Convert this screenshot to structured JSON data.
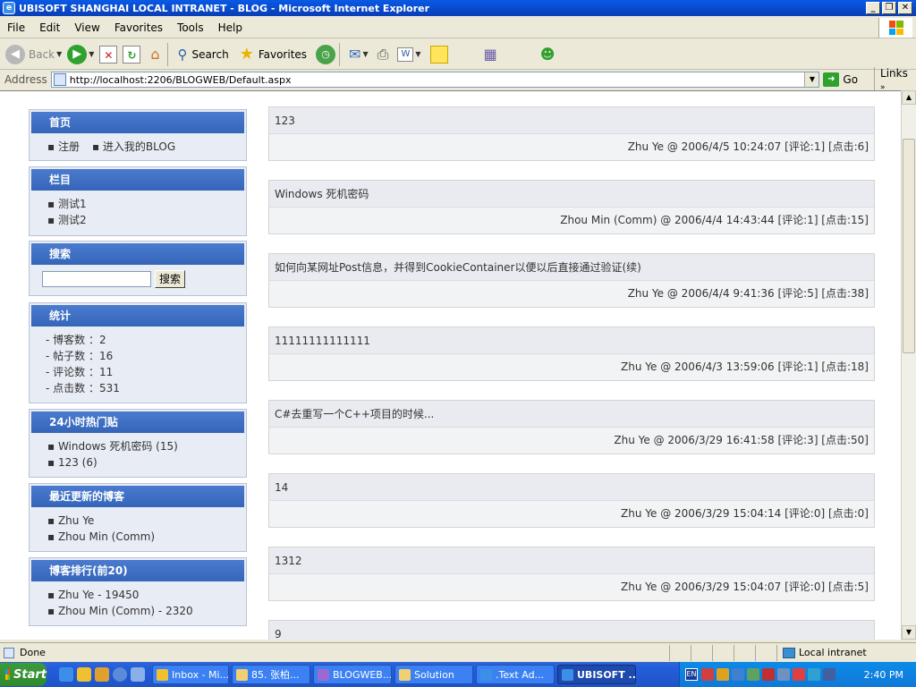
{
  "window": {
    "title": "UBISOFT SHANGHAI LOCAL INTRANET - BLOG - Microsoft Internet Explorer",
    "min": "_",
    "max": "❐",
    "close": "✕"
  },
  "menu": [
    "File",
    "Edit",
    "View",
    "Favorites",
    "Tools",
    "Help"
  ],
  "toolbar": {
    "back": "Back",
    "search": "Search",
    "favorites": "Favorites"
  },
  "address": {
    "label": "Address",
    "url": "http://localhost:2206/BLOGWEB/Default.aspx",
    "go": "Go",
    "links": "Links"
  },
  "sidebar": {
    "home": {
      "title": "首页",
      "items": [
        "▪ 注册",
        "▪ 进入我的BLOG"
      ]
    },
    "category": {
      "title": "栏目",
      "items": [
        "▪ 测试1",
        "▪ 测试2"
      ]
    },
    "search": {
      "title": "搜索",
      "button": "搜索",
      "value": ""
    },
    "stats": {
      "title": "统计",
      "items": [
        "- 博客数 ：2",
        "- 帖子数 ：16",
        "- 评论数 ：11",
        "- 点击数 ：531"
      ]
    },
    "hot": {
      "title": "24小时热门贴",
      "items": [
        "▪ Windows 死机密码 (15)",
        "▪ 123 (6)"
      ]
    },
    "recent": {
      "title": "最近更新的博客",
      "items": [
        "▪ Zhu Ye",
        "▪ Zhou Min (Comm)"
      ]
    },
    "rank": {
      "title": "博客排行(前20)",
      "items": [
        "▪ Zhu Ye - 19450",
        "▪ Zhou Min (Comm) - 2320"
      ]
    }
  },
  "posts": [
    {
      "title": "123",
      "meta": "Zhu Ye @ 2006/4/5 10:24:07 [评论:1] [点击:6]"
    },
    {
      "title": "Windows 死机密码",
      "meta": "Zhou Min (Comm) @ 2006/4/4 14:43:44 [评论:1] [点击:15]"
    },
    {
      "title": "如何向某网址Post信息，并得到CookieContainer以便以后直接通过验证(续)",
      "meta": "Zhu Ye @ 2006/4/4 9:41:36 [评论:5] [点击:38]"
    },
    {
      "title": "11111111111111",
      "meta": "Zhu Ye @ 2006/4/3 13:59:06 [评论:1] [点击:18]"
    },
    {
      "title": "C#去重写一个C++项目的时候...",
      "meta": "Zhu Ye @ 2006/3/29 16:41:58 [评论:3] [点击:50]"
    },
    {
      "title": "14",
      "meta": "Zhu Ye @ 2006/3/29 15:04:14 [评论:0] [点击:0]"
    },
    {
      "title": "1312",
      "meta": "Zhu Ye @ 2006/3/29 15:04:07 [评论:0] [点击:5]"
    },
    {
      "title": "9",
      "meta": ""
    }
  ],
  "status": {
    "text": "Done",
    "zone": "Local intranet"
  },
  "taskbar": {
    "start": "Start",
    "tasks": [
      "Inbox - Mi...",
      "85. 张柏...",
      "BLOGWEB...",
      "Solution",
      ".Text Ad...",
      "UBISOFT ..."
    ],
    "lang": "EN",
    "clock": "2:40 PM"
  }
}
